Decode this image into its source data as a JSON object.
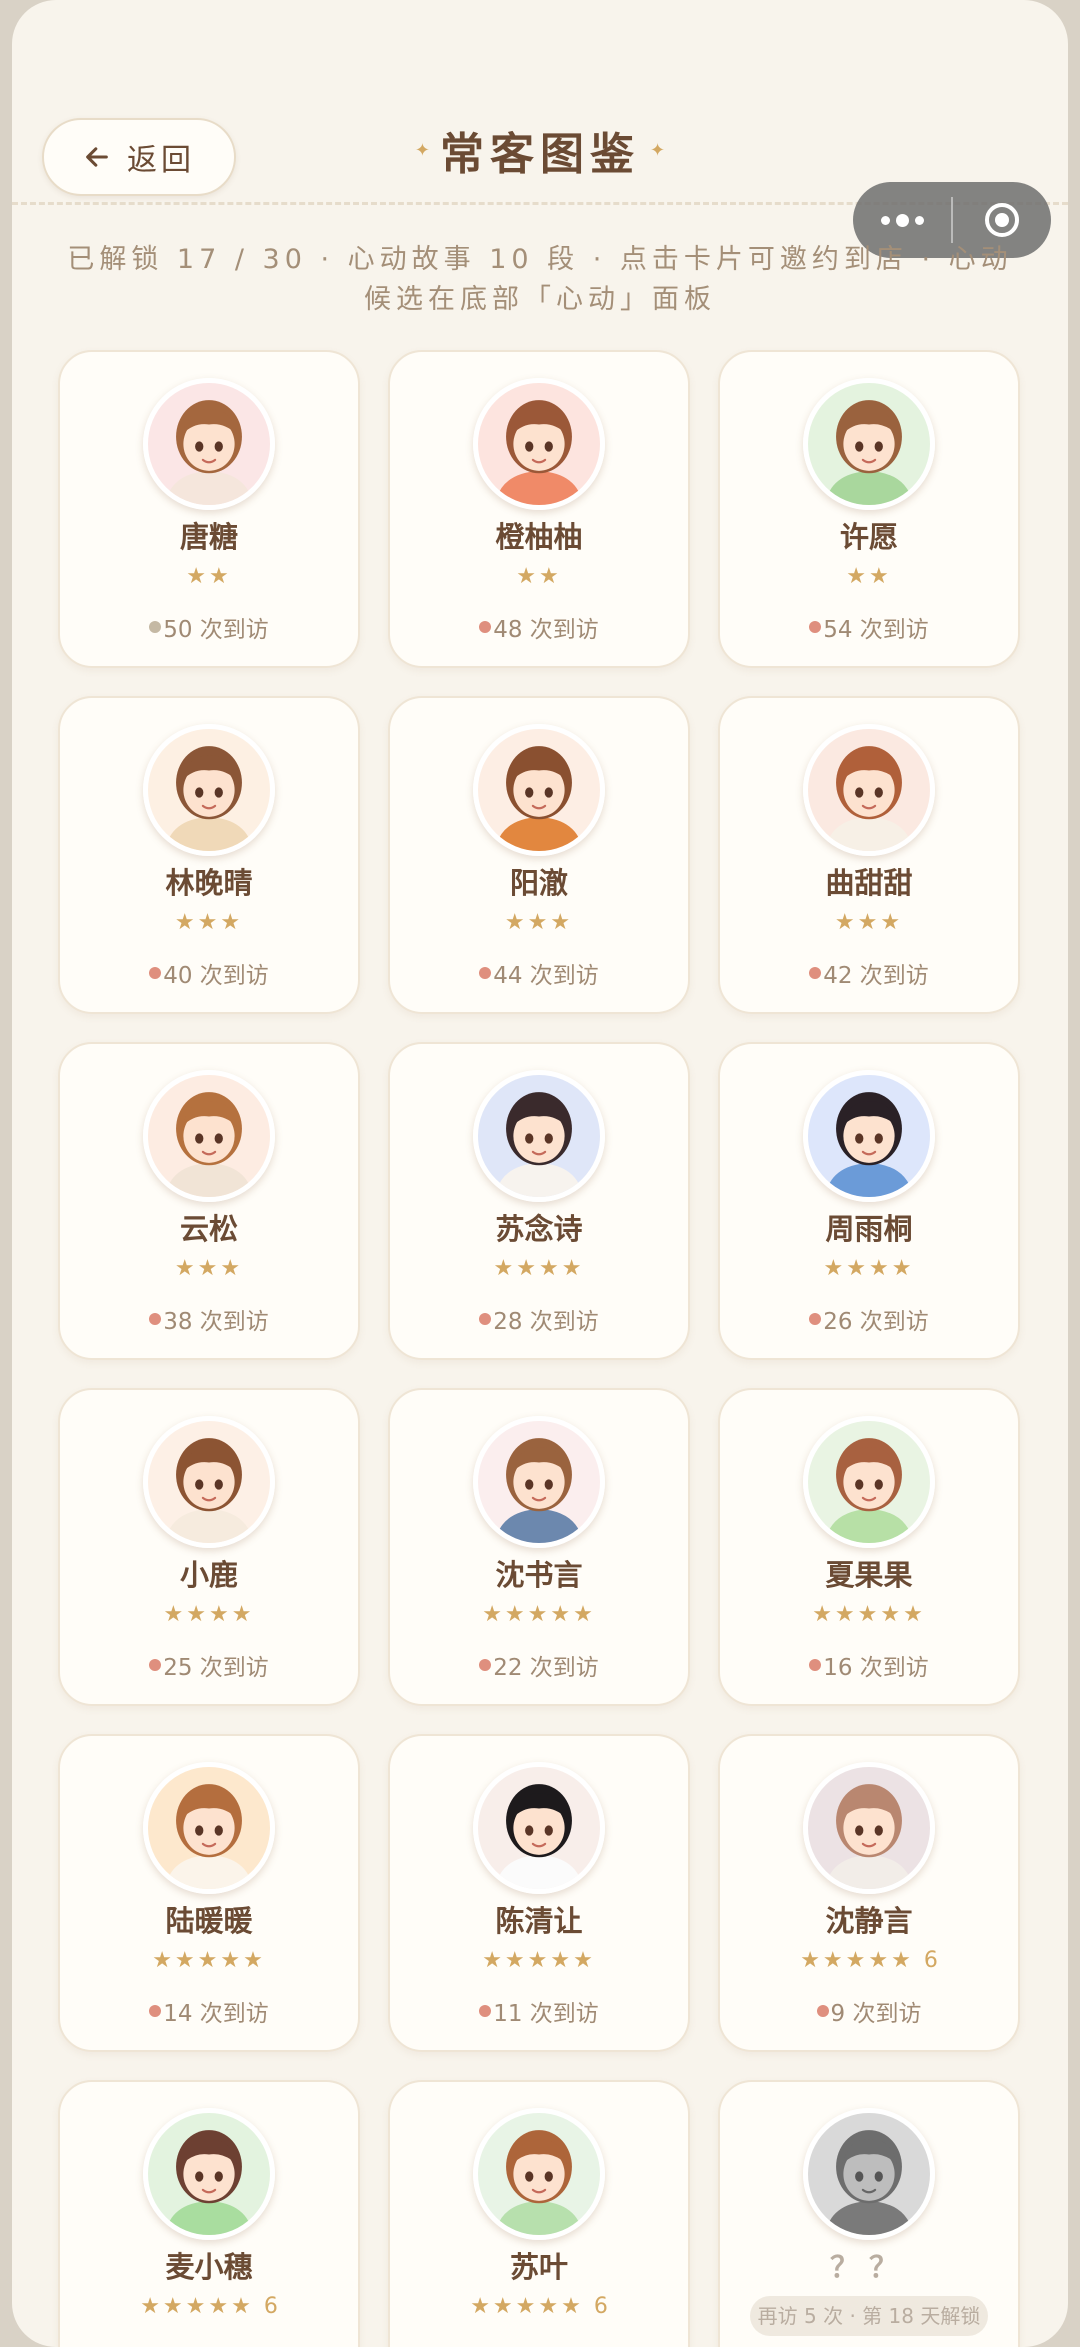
{
  "header": {
    "back_label": "返回",
    "title": "常客图鉴",
    "subtitle": "已解锁 17 / 30 · 心动故事 10 段 · 点击卡片可邀约到店 · 心动候选在底部「心动」面板"
  },
  "colors": {
    "dot_gray": "#c5b9a4",
    "dot_pink": "#df8f7e",
    "star": "#d3a862",
    "text_brown": "#6b4b34"
  },
  "cards": [
    {
      "name": "唐糖",
      "stars": "★★",
      "extra": "",
      "visits": "50 次到访",
      "dot": "gray",
      "hair": "#a4673e",
      "bg": "#fbe6e6",
      "cloth": "#f5e6dc",
      "locked": false
    },
    {
      "name": "橙柚柚",
      "stars": "★★",
      "extra": "",
      "visits": "48 次到访",
      "dot": "pink",
      "hair": "#9b5838",
      "bg": "#fde4df",
      "cloth": "#f08a68",
      "locked": false
    },
    {
      "name": "许愿",
      "stars": "★★",
      "extra": "",
      "visits": "54 次到访",
      "dot": "pink",
      "hair": "#9a623e",
      "bg": "#e4f3df",
      "cloth": "#a9d79d",
      "locked": false
    },
    {
      "name": "林晚晴",
      "stars": "★★★",
      "extra": "",
      "visits": "40 次到访",
      "dot": "pink",
      "hair": "#8b5637",
      "bg": "#fdf0e3",
      "cloth": "#f0d9b8",
      "locked": false
    },
    {
      "name": "阳澈",
      "stars": "★★★",
      "extra": "",
      "visits": "44 次到访",
      "dot": "pink",
      "hair": "#8a5030",
      "bg": "#fdeee4",
      "cloth": "#e2873f",
      "locked": false
    },
    {
      "name": "曲甜甜",
      "stars": "★★★",
      "extra": "",
      "visits": "42 次到访",
      "dot": "pink",
      "hair": "#b0603a",
      "bg": "#fbe9e1",
      "cloth": "#f7f0e6",
      "locked": false
    },
    {
      "name": "云松",
      "stars": "★★★",
      "extra": "",
      "visits": "38 次到访",
      "dot": "pink",
      "hair": "#b5713e",
      "bg": "#fdece2",
      "cloth": "#f1e4d6",
      "locked": false
    },
    {
      "name": "苏念诗",
      "stars": "★★★★",
      "extra": "",
      "visits": "28 次到访",
      "dot": "pink",
      "hair": "#3a2a2c",
      "bg": "#dfe6f8",
      "cloth": "#f7f3ee",
      "locked": false
    },
    {
      "name": "周雨桐",
      "stars": "★★★★",
      "extra": "",
      "visits": "26 次到访",
      "dot": "pink",
      "hair": "#2a2126",
      "bg": "#dde6fb",
      "cloth": "#6b9bd8",
      "locked": false
    },
    {
      "name": "小鹿",
      "stars": "★★★★",
      "extra": "",
      "visits": "25 次到访",
      "dot": "pink",
      "hair": "#8c5433",
      "bg": "#fdf0e6",
      "cloth": "#f6ebde",
      "locked": false
    },
    {
      "name": "沈书言",
      "stars": "★★★★★",
      "extra": "",
      "visits": "22 次到访",
      "dot": "pink",
      "hair": "#9a633e",
      "bg": "#fbeeee",
      "cloth": "#6c88ae",
      "locked": false
    },
    {
      "name": "夏果果",
      "stars": "★★★★★",
      "extra": "",
      "visits": "16 次到访",
      "dot": "pink",
      "hair": "#a86140",
      "bg": "#e9f4e3",
      "cloth": "#b7e0a6",
      "locked": false
    },
    {
      "name": "陆暖暖",
      "stars": "★★★★★",
      "extra": "",
      "visits": "14 次到访",
      "dot": "pink",
      "hair": "#b46e3e",
      "bg": "#fde8cd",
      "cloth": "#fbf4ea",
      "locked": false
    },
    {
      "name": "陈清让",
      "stars": "★★★★★",
      "extra": "",
      "visits": "11 次到访",
      "dot": "pink",
      "hair": "#1d1a1c",
      "bg": "#f8eeea",
      "cloth": "#fbfbfb",
      "locked": false
    },
    {
      "name": "沈静言",
      "stars": "★★★★★",
      "extra": "6",
      "visits": "9 次到访",
      "dot": "pink",
      "hair": "#b98770",
      "bg": "#ece2e4",
      "cloth": "#f2ede8",
      "locked": false
    },
    {
      "name": "麦小穗",
      "stars": "★★★★★",
      "extra": "6",
      "visits": "",
      "dot": "pink",
      "hair": "#6d4032",
      "bg": "#e3f3df",
      "cloth": "#a9dd9f",
      "locked": false
    },
    {
      "name": "苏叶",
      "stars": "★★★★★",
      "extra": "6",
      "visits": "",
      "dot": "pink",
      "hair": "#ad653a",
      "bg": "#e8f4e6",
      "cloth": "#b7e0ad",
      "locked": false
    },
    {
      "name": "？？",
      "stars": "",
      "extra": "",
      "visits": "",
      "dot": "gray",
      "hair": "#6d6d6d",
      "bg": "#d9d9d9",
      "cloth": "#7a7a7a",
      "locked": true,
      "locked_hint": "再访 5 次 · 第 18 天解锁"
    }
  ]
}
